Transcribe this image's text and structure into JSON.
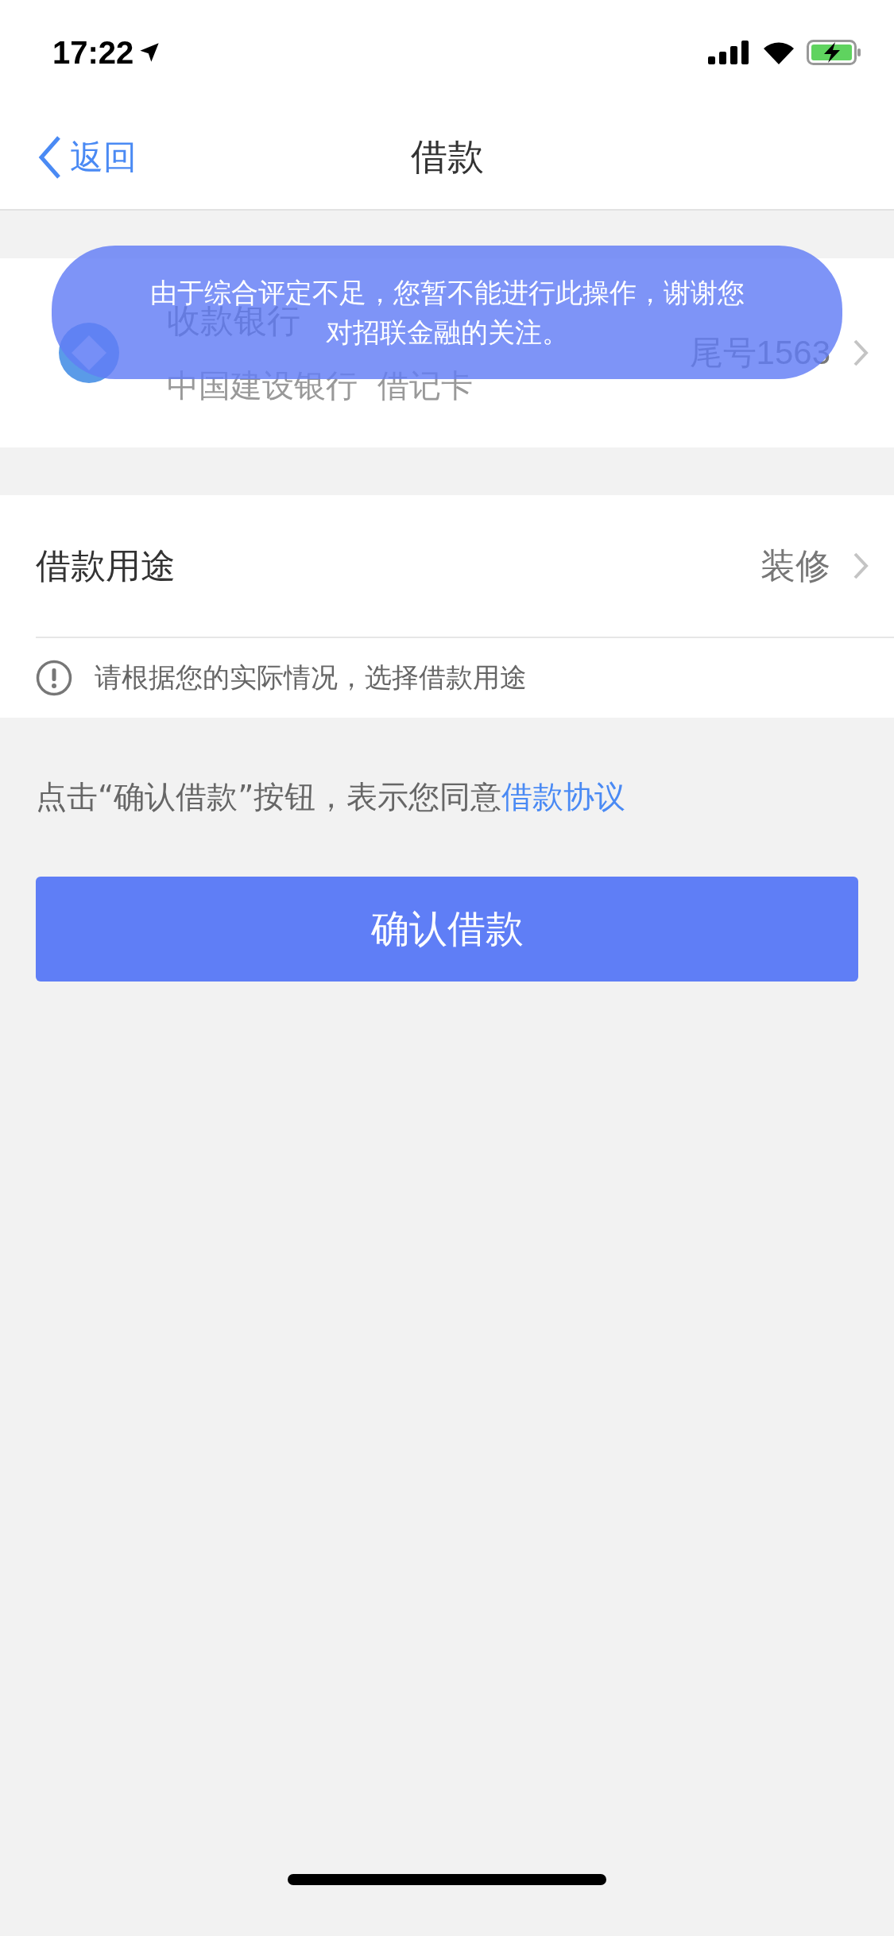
{
  "status_bar": {
    "time": "17:22"
  },
  "nav": {
    "back": "返回",
    "title": "借款"
  },
  "bank_card": {
    "label": "收款银行",
    "bank": "中国建设银行  借记卡",
    "tail": "尾号1563"
  },
  "purpose": {
    "label": "借款用途",
    "value": "装修",
    "hint": "请根据您的实际情况，选择借款用途"
  },
  "agreement": {
    "text": "点击“确认借款”按钮，表示您同意",
    "link": "借款协议"
  },
  "confirm_button": "确认借款",
  "toast": {
    "message": "由于综合评定不足，您暂不能进行此操作，谢谢您对招联金融的关注。"
  }
}
